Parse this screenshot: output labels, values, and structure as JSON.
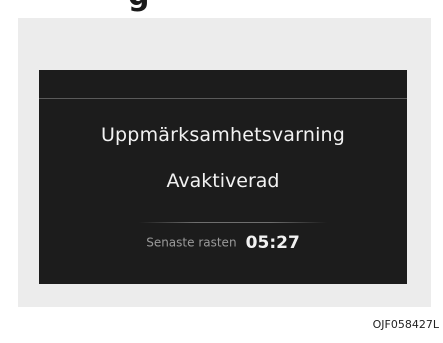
{
  "header": {
    "cut_heading": "g"
  },
  "display": {
    "title": "Uppmärksamhetsvarning",
    "status": "Avaktiverad",
    "last_rest_label": "Senaste rasten",
    "last_rest_time": "05:27"
  },
  "figure_code": "OJF058427L",
  "colors": {
    "display_background": "#1c1c1c",
    "panel_background": "#ececec",
    "text_primary": "#f2f2f2",
    "text_secondary": "#9a9a9a"
  }
}
